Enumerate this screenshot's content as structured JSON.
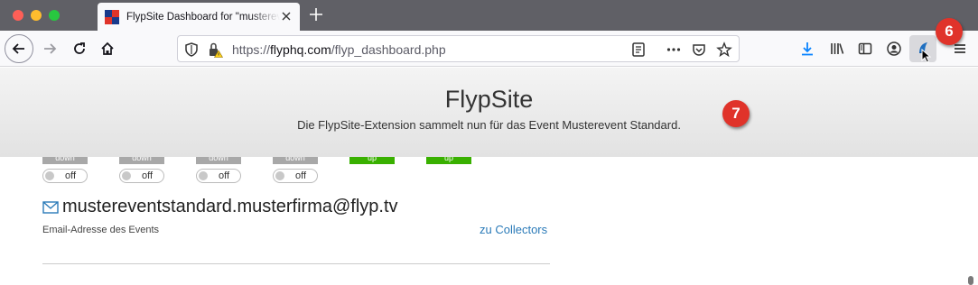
{
  "browser": {
    "tab_title": "FlypSite Dashboard for \"musterevent",
    "url_prefix": "https://",
    "url_domain": "flyphq.com",
    "url_path": "/flyp_dashboard.php"
  },
  "callouts": {
    "extension_badge": "6",
    "banner_badge": "7"
  },
  "colors": {
    "callout": "#e0332a",
    "status_up": "#39b000",
    "status_down": "#a8a8a8",
    "link": "#2a7ab8"
  },
  "banner": {
    "title": "FlypSite",
    "subtitle": "Die FlypSite-Extension sammelt nun für das Event Musterevent Standard."
  },
  "collectors": [
    {
      "status": "down",
      "toggle": "off"
    },
    {
      "status": "down",
      "toggle": "off"
    },
    {
      "status": "down",
      "toggle": "off"
    },
    {
      "status": "down",
      "toggle": "off"
    },
    {
      "status": "up"
    },
    {
      "status": "up"
    }
  ],
  "event": {
    "email": "mustereventstandard.musterfirma@flyp.tv",
    "email_caption": "Email-Adresse des Events",
    "collectors_link": "zu Collectors"
  },
  "icons": [
    "back-icon",
    "forward-icon",
    "reload-icon",
    "home-icon",
    "shield-icon",
    "lock-warning-icon",
    "reader-view-icon",
    "more-icon",
    "pocket-icon",
    "bookmark-star-icon",
    "download-icon",
    "library-icon",
    "sidebar-icon",
    "account-icon",
    "flypsite-extension-icon",
    "menu-icon",
    "mail-icon"
  ]
}
